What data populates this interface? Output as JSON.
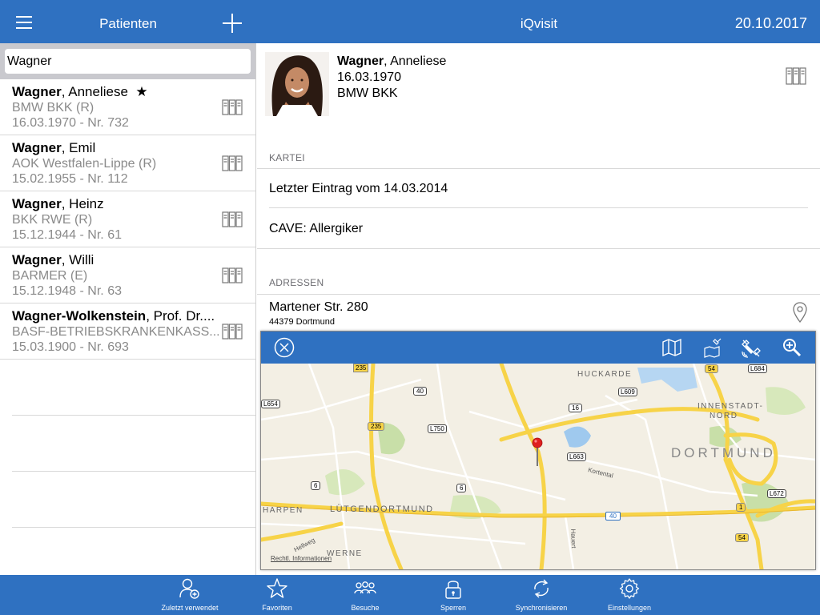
{
  "header": {
    "left_title": "Patienten",
    "center_title": "iQvisit",
    "date": "20.10.2017"
  },
  "search": {
    "value": "Wagner"
  },
  "patients": [
    {
      "surname": "Wagner",
      "given": ", Anneliese",
      "star": "★",
      "insurance": "BMW BKK (R)",
      "dob_nr": "16.03.1970 - Nr. 732"
    },
    {
      "surname": "Wagner",
      "given": ", Emil",
      "star": "",
      "insurance": "AOK Westfalen-Lippe (R)",
      "dob_nr": "15.02.1955 - Nr. 112"
    },
    {
      "surname": "Wagner",
      "given": ", Heinz",
      "star": "",
      "insurance": "BKK RWE (R)",
      "dob_nr": "15.12.1944 - Nr. 61"
    },
    {
      "surname": "Wagner",
      "given": ", Willi",
      "star": "",
      "insurance": "BARMER (E)",
      "dob_nr": "15.12.1948 - Nr. 63"
    },
    {
      "surname": "Wagner-Wolkenstein",
      "given": ", Prof. Dr....",
      "star": "",
      "insurance": "BASF-BETRIEBSKRANKENKASS...",
      "dob_nr": "15.03.1900 - Nr. 693"
    }
  ],
  "detail": {
    "surname": "Wagner",
    "given": ", Anneliese",
    "dob": "16.03.1970",
    "insurance": "BMW BKK",
    "kartei_label": "KARTEI",
    "last_entry": "Letzter Eintrag vom 14.03.2014",
    "cave": "CAVE: Allergiker",
    "adressen_label": "ADRESSEN",
    "street": "Martener Str. 280",
    "city": "44379 Dortmund"
  },
  "map": {
    "legal": "Rechtl. Informationen",
    "place_huckarde": "HUCKARDE",
    "place_innenstadt": "INNENSTADT-",
    "place_nord": "NORD",
    "place_dortmund": "DORTMUND",
    "place_harpen": "HARPEN",
    "place_luetgendortmund": "LÜTGENDORTMUND",
    "place_werne": "WERNE",
    "street_kortental": "Kortental",
    "street_hauert": "Hauert",
    "street_hellweg": "Hellweg",
    "shields": {
      "r235a": "235",
      "r235b": "235",
      "r40": "40",
      "l654": "L654",
      "l750": "L750",
      "r16": "16",
      "r54a": "54",
      "l684": "L684",
      "l609": "L609",
      "l663": "L663",
      "r6a": "6",
      "r6b": "6",
      "a40": "40",
      "r1": "1",
      "l672": "L672",
      "r54b": "54"
    }
  },
  "tabs": [
    {
      "label": "Zuletzt verwendet",
      "icon": "recent-user-icon"
    },
    {
      "label": "Favoriten",
      "icon": "star-icon"
    },
    {
      "label": "Besuche",
      "icon": "group-icon"
    },
    {
      "label": "Sperren",
      "icon": "lock-icon"
    },
    {
      "label": "Synchronisieren",
      "icon": "sync-icon"
    },
    {
      "label": "Einstellungen",
      "icon": "gear-icon"
    }
  ],
  "colors": {
    "brand_blue": "#2f71c1",
    "road_yellow": "#f7d348",
    "map_bg": "#f3efe4",
    "park_green": "#c8dfa8",
    "water": "#9fc9ee"
  }
}
